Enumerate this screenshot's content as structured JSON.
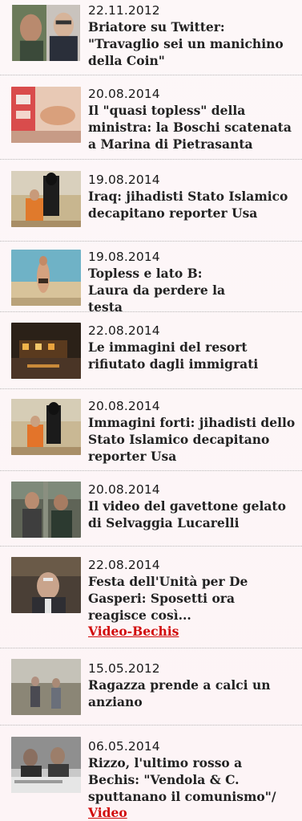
{
  "items": [
    {
      "date": "22.11.2012",
      "title": "Briatore su Twitter: \"Travaglio sei un manichino della Coin\"",
      "link": ""
    },
    {
      "date": "20.08.2014",
      "title": "Il \"quasi topless\" della ministra: la Boschi scatenata a Marina di Pietrasanta",
      "link": ""
    },
    {
      "date": "19.08.2014",
      "title": "Iraq: jihadisti Stato Islamico decapitano reporter Usa",
      "link": ""
    },
    {
      "date": "19.08.2014",
      "title": "Topless e lato B: Laura da perdere la testa",
      "link": ""
    },
    {
      "date": "22.08.2014",
      "title": "Le immagini del resort rifiutato dagli immigrati",
      "link": ""
    },
    {
      "date": "20.08.2014",
      "title": "Immagini forti: jihadisti dello Stato Islamico decapitano reporter Usa",
      "link": ""
    },
    {
      "date": "20.08.2014",
      "title": "Il video del gavettone gelato di Selvaggia Lucarelli",
      "link": ""
    },
    {
      "date": "22.08.2014",
      "title": "Festa dell'Unità per De Gasperi: Sposetti ora reagisce così...",
      "link": "Video-Bechis"
    },
    {
      "date": "15.05.2012",
      "title": "Ragazza prende a calci un anziano",
      "link": ""
    },
    {
      "date": "06.05.2014",
      "title": "Rizzo, l'ultimo rosso a Bechis: \"Vendola & C. sputtanano il comunismo\"/",
      "link": "Video"
    }
  ]
}
